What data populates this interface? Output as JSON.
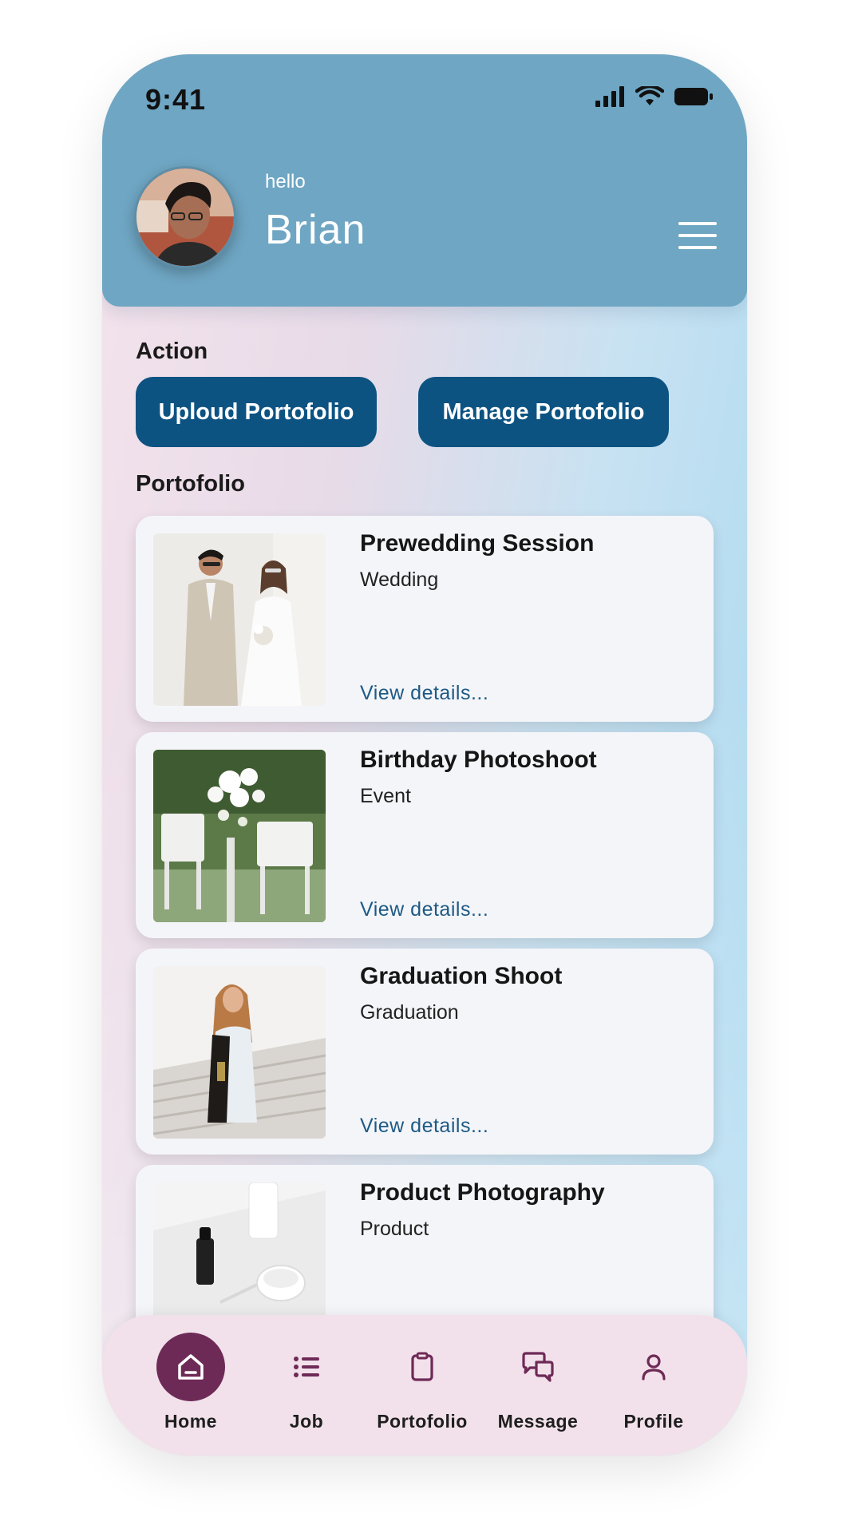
{
  "status_bar": {
    "time": "9:41"
  },
  "header": {
    "greeting": "hello",
    "user_name": "Brian"
  },
  "action": {
    "title": "Action",
    "buttons": [
      "Uploud Portofolio",
      "Manage Portofolio"
    ]
  },
  "portfolio": {
    "title": "Portofolio",
    "link_label": "View details...",
    "items": [
      {
        "title": "Prewedding Session",
        "category": "Wedding"
      },
      {
        "title": "Birthday Photoshoot",
        "category": "Event"
      },
      {
        "title": "Graduation Shoot",
        "category": "Graduation"
      },
      {
        "title": "Product Photography",
        "category": "Product"
      }
    ]
  },
  "bottom_nav": {
    "active": "Home",
    "items": [
      {
        "label": "Home",
        "icon": "home-icon"
      },
      {
        "label": "Job",
        "icon": "list-icon"
      },
      {
        "label": "Portofolio",
        "icon": "clipboard-icon"
      },
      {
        "label": "Message",
        "icon": "chat-icon"
      },
      {
        "label": "Profile",
        "icon": "user-icon"
      }
    ]
  },
  "colors": {
    "header": "#6fa6c3",
    "button": "#0d5382",
    "link": "#1d5a85",
    "nav_active": "#6e2a57",
    "nav_bg": "#f2e1ea"
  }
}
